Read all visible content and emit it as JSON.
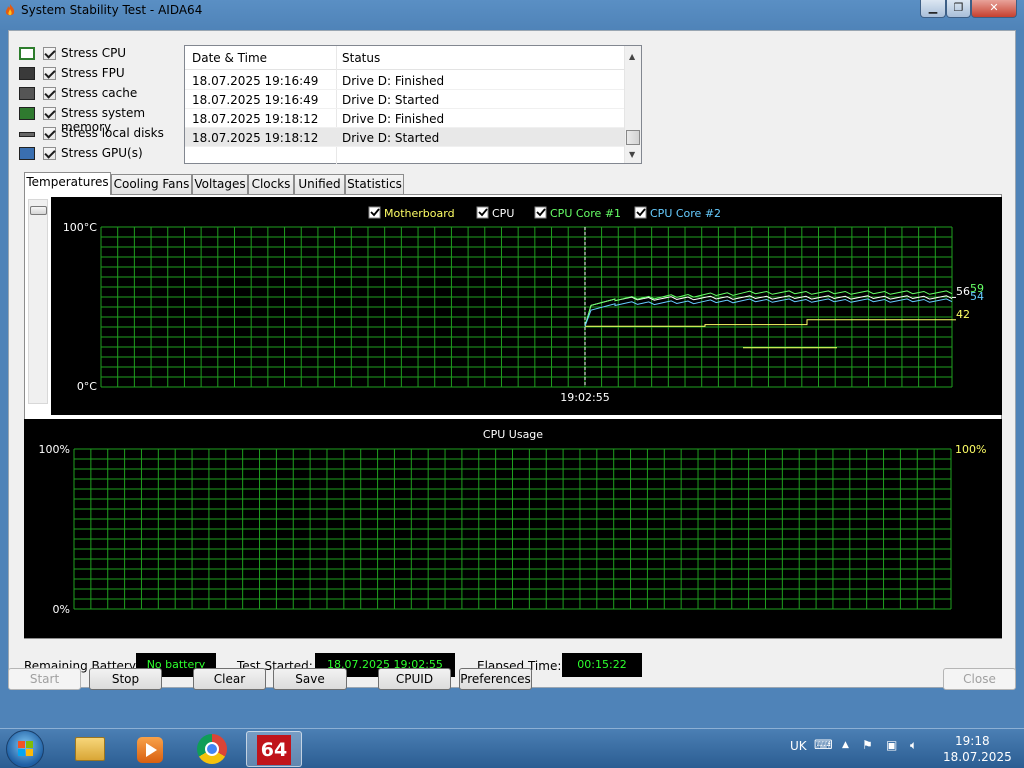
{
  "window": {
    "title": "System Stability Test - AIDA64"
  },
  "stress_options": [
    {
      "label": "Stress CPU",
      "checked": true,
      "icon": "cpu-icon"
    },
    {
      "label": "Stress FPU",
      "checked": true,
      "icon": "fpu-icon"
    },
    {
      "label": "Stress cache",
      "checked": true,
      "icon": "cache-icon"
    },
    {
      "label": "Stress system memory",
      "checked": true,
      "icon": "memory-icon"
    },
    {
      "label": "Stress local disks",
      "checked": true,
      "icon": "disk-icon"
    },
    {
      "label": "Stress GPU(s)",
      "checked": true,
      "icon": "gpu-icon"
    }
  ],
  "log": {
    "columns": [
      "Date & Time",
      "Status"
    ],
    "rows": [
      {
        "datetime": "18.07.2025 19:16:49",
        "status": "Drive D: Finished"
      },
      {
        "datetime": "18.07.2025 19:16:49",
        "status": "Drive D: Started"
      },
      {
        "datetime": "18.07.2025 19:18:12",
        "status": "Drive D: Finished"
      },
      {
        "datetime": "18.07.2025 19:18:12",
        "status": "Drive D: Started"
      }
    ]
  },
  "tabs": [
    "Temperatures",
    "Cooling Fans",
    "Voltages",
    "Clocks",
    "Unified",
    "Statistics"
  ],
  "active_tab": "Temperatures",
  "temp_graph": {
    "legend": [
      {
        "label": "Motherboard",
        "color": "#ffff66"
      },
      {
        "label": "CPU",
        "color": "#ffffff"
      },
      {
        "label": "CPU Core #1",
        "color": "#66ff66"
      },
      {
        "label": "CPU Core #2",
        "color": "#66ccff"
      }
    ],
    "y_max_label": "100°C",
    "y_min_label": "0°C",
    "marker_time": "19:02:55",
    "readouts": [
      {
        "value": "59",
        "color": "#66ff66"
      },
      {
        "value": "56",
        "color": "#ffffff"
      },
      {
        "value": "54",
        "color": "#66ccff"
      },
      {
        "value": "42",
        "color": "#ffff66"
      }
    ],
    "grid_color": "#1f9f1f"
  },
  "chart_data": {
    "type": "line",
    "title": "",
    "ylabel": "°C",
    "ylim": [
      0,
      100
    ],
    "x_marker": "19:02:55",
    "series": [
      {
        "name": "Motherboard",
        "values": [
          38,
          38,
          42,
          42
        ]
      },
      {
        "name": "CPU",
        "values": [
          38,
          55,
          56,
          56
        ]
      },
      {
        "name": "CPU Core #1",
        "values": [
          38,
          55,
          58,
          59
        ]
      },
      {
        "name": "CPU Core #2",
        "values": [
          38,
          52,
          54,
          54
        ]
      }
    ]
  },
  "cpu_graph": {
    "title": "CPU Usage",
    "y_max_label": "100%",
    "y_min_label": "0%",
    "current_value": "100%",
    "current_color": "#ffff66"
  },
  "status": {
    "battery_label": "Remaining Battery:",
    "battery_value": "No battery",
    "started_label": "Test Started:",
    "started_value": "18.07.2025 19:02:55",
    "elapsed_label": "Elapsed Time:",
    "elapsed_value": "00:15:22"
  },
  "buttons": {
    "start": "Start",
    "stop": "Stop",
    "clear": "Clear",
    "save": "Save",
    "cpuid": "CPUID",
    "preferences": "Preferences",
    "close": "Close"
  },
  "taskbar": {
    "items": [
      "start-orb",
      "file-explorer",
      "media-player",
      "chrome",
      "aida64"
    ],
    "aida_label": "64",
    "language": "UK",
    "time": "19:18",
    "date": "18.07.2025"
  }
}
